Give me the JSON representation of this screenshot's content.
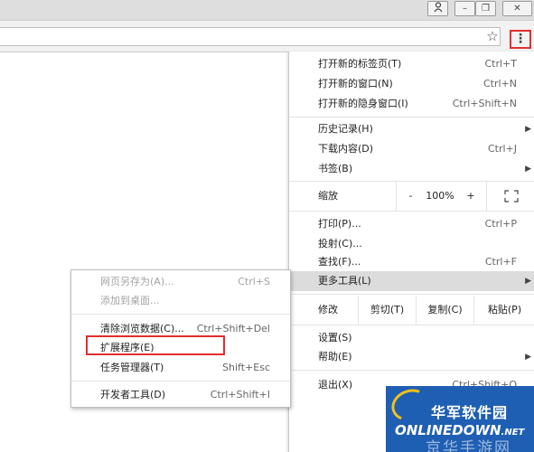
{
  "window": {
    "user_icon": "person-icon",
    "minimize": "–",
    "restore": "❐",
    "close": "✕"
  },
  "toolbar": {
    "star_icon": "☆",
    "menu_icon": "⋮"
  },
  "menu": {
    "new_tab": {
      "label": "打开新的标签页(T)",
      "shortcut": "Ctrl+T"
    },
    "new_window": {
      "label": "打开新的窗口(N)",
      "shortcut": "Ctrl+N"
    },
    "incognito": {
      "label": "打开新的隐身窗口(I)",
      "shortcut": "Ctrl+Shift+N"
    },
    "history": {
      "label": "历史记录(H)",
      "arrow": "▶"
    },
    "downloads": {
      "label": "下载内容(D)",
      "shortcut": "Ctrl+J"
    },
    "bookmarks": {
      "label": "书签(B)",
      "arrow": "▶"
    },
    "zoom": {
      "label": "缩放",
      "minus": "-",
      "value": "100%",
      "plus": "+",
      "fullscreen": "⛶"
    },
    "print": {
      "label": "打印(P)...",
      "shortcut": "Ctrl+P"
    },
    "cast": {
      "label": "投射(C)..."
    },
    "find": {
      "label": "查找(F)...",
      "shortcut": "Ctrl+F"
    },
    "more_tools": {
      "label": "更多工具(L)",
      "arrow": "▶"
    },
    "edit": {
      "label": "修改",
      "cut": "剪切(T)",
      "copy": "复制(C)",
      "paste": "粘贴(P)"
    },
    "settings": {
      "label": "设置(S)"
    },
    "help": {
      "label": "帮助(E)",
      "arrow": "▶"
    },
    "exit": {
      "label": "退出(X)",
      "shortcut": "Ctrl+Shift+Q"
    }
  },
  "submenu": {
    "save_page": {
      "label": "网页另存为(A)...",
      "shortcut": "Ctrl+S"
    },
    "add_desktop": {
      "label": "添加到桌面..."
    },
    "clear_data": {
      "label": "清除浏览数据(C)...",
      "shortcut": "Ctrl+Shift+Del"
    },
    "extensions": {
      "label": "扩展程序(E)"
    },
    "task_manager": {
      "label": "任务管理器(T)",
      "shortcut": "Shift+Esc"
    },
    "devtools": {
      "label": "开发者工具(D)",
      "shortcut": "Ctrl+Shift+I"
    }
  },
  "watermark": {
    "title": "华军软件园",
    "brand": "ONLINEDOWN",
    "suffix": ".NET",
    "overlay": "京华手游网"
  }
}
